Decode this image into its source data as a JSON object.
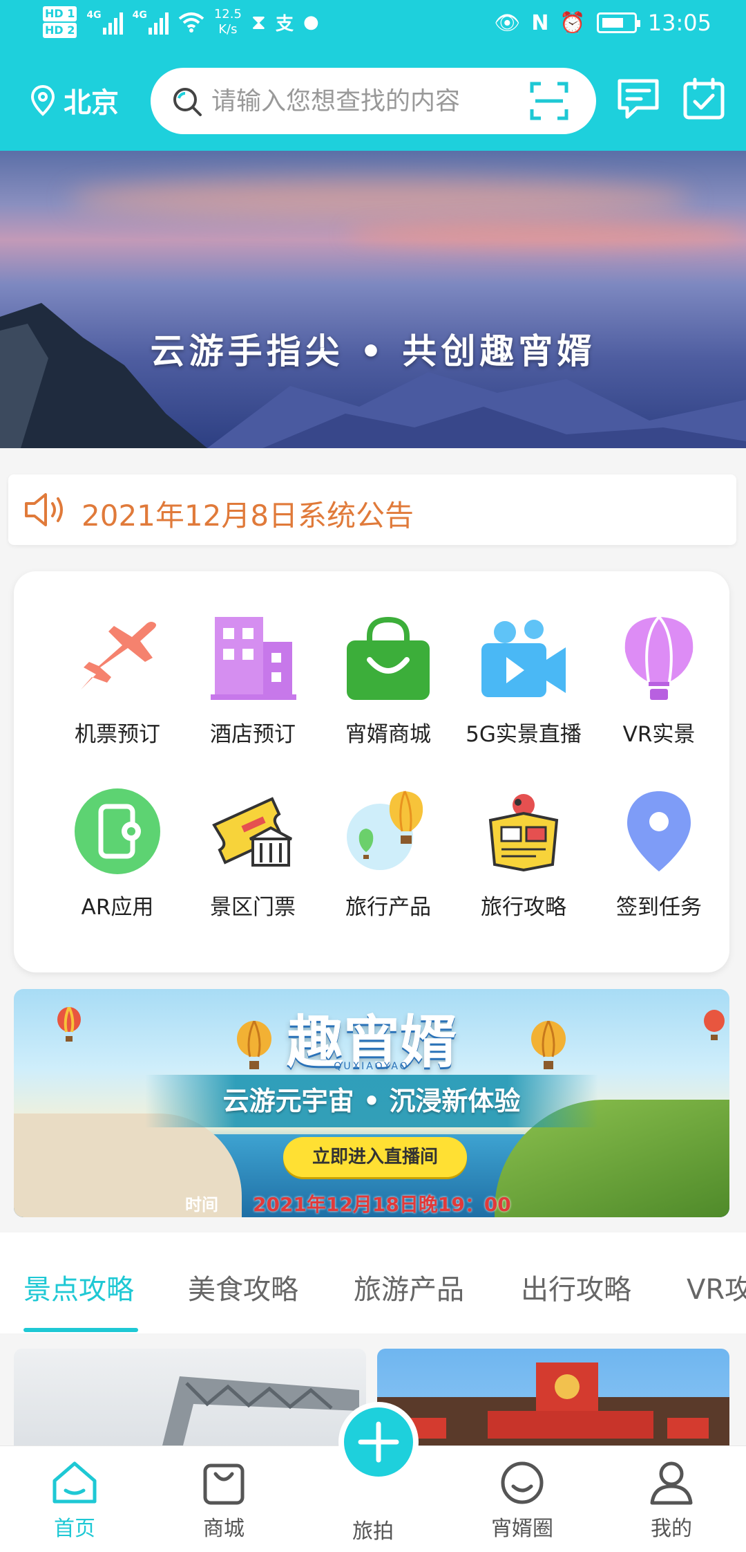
{
  "status_bar": {
    "sim1": "HD 1",
    "sim2": "HD 2",
    "net1": "4G",
    "net2": "4G",
    "speed_value": "12.5",
    "speed_unit": "K/s",
    "time": "13:05"
  },
  "header": {
    "location": "北京",
    "search_placeholder": "请输入您想查找的内容"
  },
  "hero": {
    "slogan": "云游手指尖 • 共创趣宵婿"
  },
  "notice": {
    "text": "2021年12月8日系统公告"
  },
  "menu": {
    "items": [
      {
        "label": "机票预订",
        "icon": "airplane-icon"
      },
      {
        "label": "酒店预订",
        "icon": "hotel-icon"
      },
      {
        "label": "宵婿商城",
        "icon": "shopping-bag-icon"
      },
      {
        "label": "5G实景直播",
        "icon": "video-camera-icon"
      },
      {
        "label": "VR实景",
        "icon": "hot-air-balloon-icon"
      },
      {
        "label": "AR应用",
        "icon": "ar-phone-icon"
      },
      {
        "label": "景区门票",
        "icon": "ticket-icon"
      },
      {
        "label": "旅行产品",
        "icon": "balloons-icon"
      },
      {
        "label": "旅行攻略",
        "icon": "travel-guide-icon"
      },
      {
        "label": "签到任务",
        "icon": "location-pin-icon"
      }
    ]
  },
  "promo": {
    "title": "趣宵婿",
    "title_pinyin": "QUXIAOYAO",
    "subtitle": "云游元宇宙 • 沉浸新体验",
    "button": "立即进入直播间",
    "time_label": "时间",
    "time": "2021年12月18日晚19：00"
  },
  "tabs": {
    "items": [
      "景点攻略",
      "美食攻略",
      "旅游产品",
      "出行攻略",
      "VR攻"
    ],
    "active_index": 0
  },
  "bottom_nav": {
    "items": [
      {
        "label": "首页",
        "icon": "home-icon"
      },
      {
        "label": "商城",
        "icon": "shopping-bag-icon"
      },
      {
        "label": "旅拍",
        "icon": "plus-icon"
      },
      {
        "label": "宵婿圈",
        "icon": "smile-icon"
      },
      {
        "label": "我的",
        "icon": "user-icon"
      }
    ],
    "active_index": 0
  },
  "colors": {
    "primary": "#1ed0dc",
    "notice": "#e07a3a",
    "promo_time": "#e03a3a"
  }
}
